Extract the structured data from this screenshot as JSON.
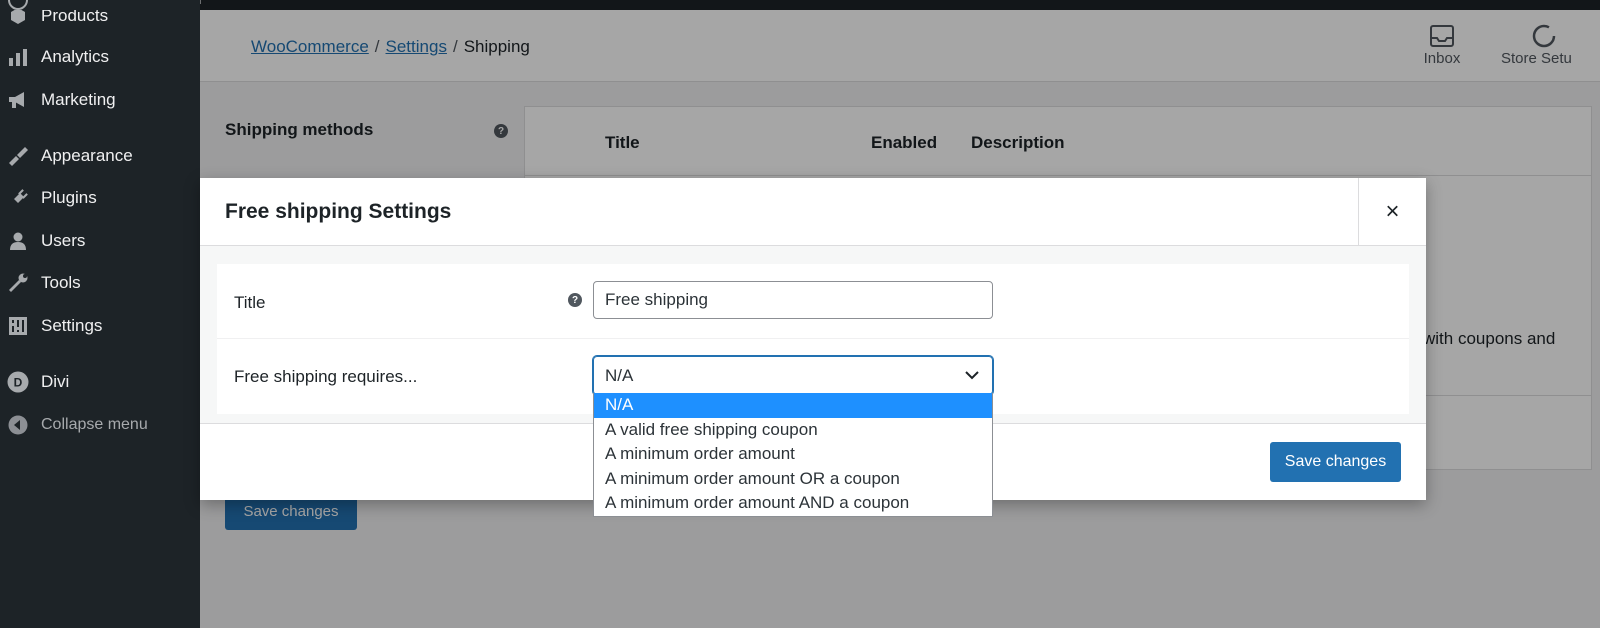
{
  "sidebar": {
    "items": [
      {
        "label": "Products",
        "icon": "products-icon"
      },
      {
        "label": "Analytics",
        "icon": "analytics-icon"
      },
      {
        "label": "Marketing",
        "icon": "megaphone-icon"
      },
      {
        "label": "Appearance",
        "icon": "paintbrush-icon"
      },
      {
        "label": "Plugins",
        "icon": "plugin-icon"
      },
      {
        "label": "Users",
        "icon": "users-icon"
      },
      {
        "label": "Tools",
        "icon": "wrench-icon"
      },
      {
        "label": "Settings",
        "icon": "settings-icon"
      },
      {
        "label": "Divi",
        "icon": "divi-icon"
      },
      {
        "label": "Collapse menu",
        "icon": "collapse-icon"
      }
    ]
  },
  "header": {
    "breadcrumb": [
      "WooCommerce",
      "Settings",
      "Shipping"
    ],
    "breadcrumb_sep": "/",
    "inbox_label": "Inbox",
    "store_setup_label": "Store Setu"
  },
  "background": {
    "section_label": "Shipping methods",
    "columns": [
      "Title",
      "Enabled",
      "Description"
    ],
    "desc_fragment": "with coupons and",
    "save_label": "Save changes"
  },
  "modal": {
    "title": "Free shipping Settings",
    "close_glyph": "×",
    "fields": {
      "title_label": "Title",
      "title_value": "Free shipping",
      "requires_label": "Free shipping requires...",
      "requires_value": "N/A"
    },
    "help_glyph": "?",
    "save_label": "Save changes"
  },
  "dropdown": {
    "options": [
      "N/A",
      "A valid free shipping coupon",
      "A minimum order amount",
      "A minimum order amount OR a coupon",
      "A minimum order amount AND a coupon"
    ],
    "selected_index": 0
  },
  "colors": {
    "accent": "#2271b1",
    "sidebar_bg": "#1d2327",
    "option_highlight": "#1e90ff"
  }
}
